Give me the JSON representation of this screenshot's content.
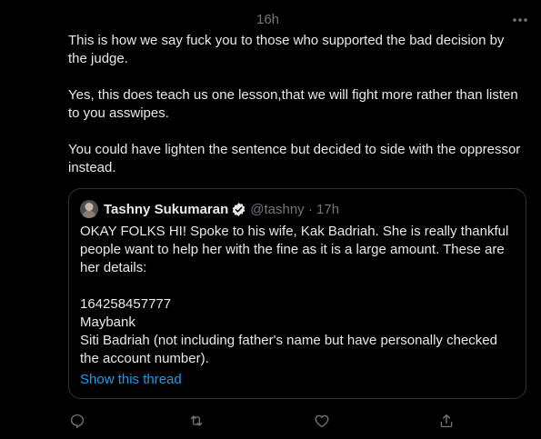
{
  "tweet": {
    "timestamp": "16h",
    "text": "This is how we say fuck you to those who supported the bad decision by the judge.\n\nYes, this does teach us one lesson,that we will fight more rather than listen to you asswipes.\n\nYou could have lighten the sentence but decided to side with the oppressor instead."
  },
  "quote": {
    "author_name": "Tashny Sukumaran",
    "author_meta": "@tashny · 17h",
    "text": "OKAY FOLKS HI! Spoke to his wife, Kak Badriah. She is really thankful people want to help her with the fine as it is a large amount. These are her details:\n\n164258457777\nMaybank\nSiti Badriah (not including father's name but have personally checked the account number).",
    "show_thread_label": "Show this thread"
  },
  "icons": {
    "more": "more-horizontal-icon",
    "verified": "verified-badge-icon",
    "reply": "reply-icon",
    "retweet": "retweet-icon",
    "like": "heart-icon",
    "share": "share-icon"
  },
  "colors": {
    "background": "#000000",
    "text": "#e7e9ea",
    "muted": "#71767b",
    "accent": "#1d9bf0",
    "border": "#2f3336"
  }
}
